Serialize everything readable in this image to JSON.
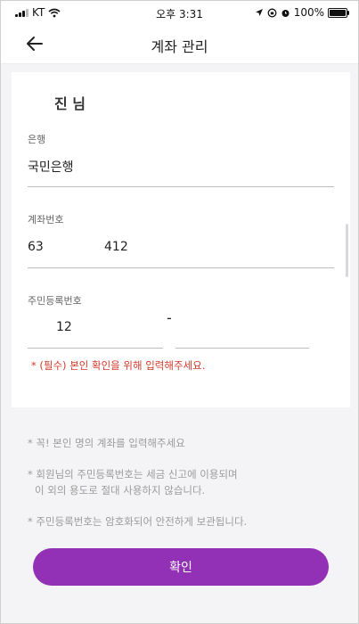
{
  "status": {
    "carrier": "KT",
    "time": "오후 3:31",
    "battery": "100%",
    "battery_level": 1.0
  },
  "appbar": {
    "title": "계좌 관리"
  },
  "account": {
    "name": "진 님",
    "bank_label": "은행",
    "bank_value": "국민은행",
    "account_label": "계좌번호",
    "account_value_1": "63",
    "account_value_2": "412",
    "rrn_label": "주민등록번호",
    "rrn_front": "12",
    "rrn_dash": "-",
    "rrn_back": "",
    "notice": "* (필수) 본인 확인을 위해 입력해주세요."
  },
  "info": {
    "line1": "* 꼭! 본인 명의 계좌를 입력해주세요",
    "line2a": "* 회원님의 주민등록번호는 세금 신고에 이용되며",
    "line2b": "이 외의 용도로 절대 사용하지 않습니다.",
    "line3": "* 주민등록번호는 암호화되어 안전하게 보관됩니다."
  },
  "confirm_button": {
    "label": "확인",
    "color": "#9230b6"
  },
  "icons": [
    "signal-icon",
    "wifi-icon",
    "location-arrow-icon",
    "lock-rotation-icon",
    "alarm-icon",
    "battery-icon",
    "back-arrow-icon"
  ]
}
